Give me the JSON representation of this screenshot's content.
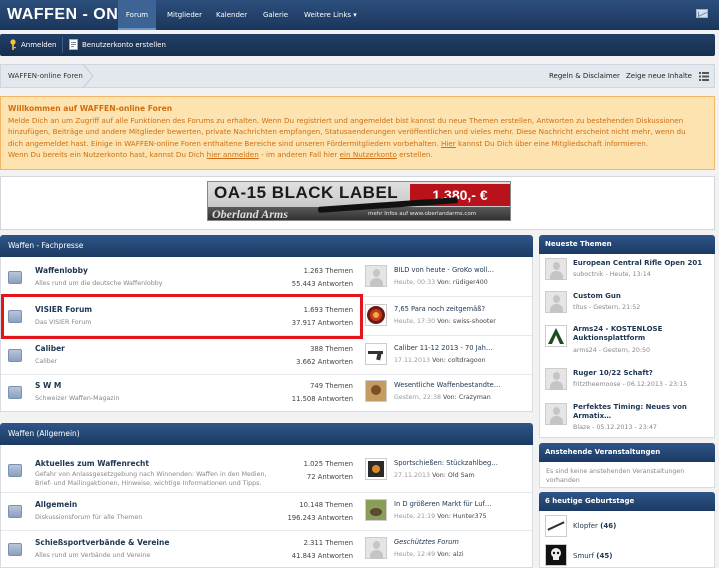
{
  "header": {
    "logo": "WAFFEN - ONLINE",
    "nav": [
      "Forum",
      "Mitglieder",
      "Kalender",
      "Galerie",
      "Weitere Links ▾"
    ]
  },
  "loginbar": {
    "login": "Anmelden",
    "register": "Benutzerkonto erstellen"
  },
  "breadcrumb": {
    "home": "WAFFEN-online Foren",
    "rules": "Regeln & Disclaimer",
    "new_content": "Zeige neue Inhalte"
  },
  "notice": {
    "title": "Willkommen auf WAFFEN-online Foren",
    "line1": "Melde Dich an um Zugriff auf alle Funktionen des Forums zu erhalten. Wenn Du registriert und angemeldet bist kannst du neue Themen erstellen, Antworten zu bestehenden Diskussionen",
    "line2": "hinzufügen, Beiträge und andere Mitglieder bewerten, private Nachrichten empfangen, Statusaenderungen veröffentlichen und vieles mehr. Diese Nachricht erscheint nicht mehr, wenn du",
    "line3a": "dich angemeldet hast. Einige in WAFFEN-online Foren enthaltene Bereiche sind unseren Fördermitgliedern vorbehalten. ",
    "line3_link": "Hier",
    "line3b": " kannst Du Dich über eine Mitgliedschaft informieren.",
    "line4a": "Wenn Du bereits ein Nutzerkonto hast, kannst Du Dich ",
    "line4_link1": "hier anmelden",
    "line4b": " - im anderen Fall hier ",
    "line4_link2": "ein Nutzerkonto",
    "line4c": " erstellen."
  },
  "banner": {
    "title": "OA-15 BLACK LABEL",
    "price": "1.380,- €",
    "brand": "Oberland Arms",
    "url": "mehr Infos auf www.oberlandarms.com"
  },
  "categories": [
    {
      "title": "Waffen - Fachpresse",
      "forums": [
        {
          "title": "Waffenlobby",
          "desc": "Alles rund um die deutsche Waffenlobby",
          "threads": "1.263 Themen",
          "posts": "55.443 Antworten",
          "last_title": "BILD von heute - GroKo woll…",
          "last_time": "Heute, 00:33",
          "last_by_label": "Von:",
          "last_by": "rüdiger400"
        },
        {
          "title": "VISIER Forum",
          "desc": "Das VISIER Forum",
          "threads": "1.693 Themen",
          "posts": "37.917 Antworten",
          "last_title": "7,65 Para noch zeitgemäß?",
          "last_time": "Heute, 17:30",
          "last_by_label": "Von:",
          "last_by": "swiss-shooter"
        },
        {
          "title": "Caliber",
          "desc": "Caliber",
          "threads": "388 Themen",
          "posts": "3.662 Antworten",
          "last_title": "Caliber 11-12 2013 - 70 Jah…",
          "last_time": "17.11.2013",
          "last_by_label": "Von:",
          "last_by": "coltdragoon"
        },
        {
          "title": "S W M",
          "desc": "Schweizer Waffen-Magazin",
          "threads": "749 Themen",
          "posts": "11.508 Antworten",
          "last_title": "Wesentliche Waffenbestandte…",
          "last_time": "Gestern, 22:38",
          "last_by_label": "Von:",
          "last_by": "Crazyman"
        }
      ]
    },
    {
      "title": "Waffen (Allgemein)",
      "forums": [
        {
          "title": "Aktuelles zum Waffenrecht",
          "desc": "Gefahr von Anlassgesetzgebung nach Winnenden: Waffen in den Medien, Brief- und Mailingaktionen, Hinweise, wichtige Informationen und Tipps.",
          "threads": "1.025 Themen",
          "posts": "72 Antworten",
          "last_title": "Sportschießen: Stückzahlbeg…",
          "last_time": "27.11.2013",
          "last_by_label": "Von:",
          "last_by": "Old Sam"
        },
        {
          "title": "Allgemein",
          "desc": "Diskussionsforum für alle Themen",
          "threads": "10.148 Themen",
          "posts": "196.243 Antworten",
          "last_title": "In D größeren Markt für Luf…",
          "last_time": "Heute, 21:19",
          "last_by_label": "Von:",
          "last_by": "Hunter375"
        },
        {
          "title": "Schießsportverbände & Vereine",
          "desc": "Alles rund um Verbände und Vereine",
          "threads": "2.311 Themen",
          "posts": "41.843 Antworten",
          "last_title": "Geschütztes Forum",
          "last_time": "Heute, 12:49",
          "last_by_label": "Von:",
          "last_by": "alzi"
        }
      ]
    }
  ],
  "sidebar": {
    "new_topics_title": "Neueste Themen",
    "new_topics": [
      {
        "title": "European Central Rifle Open 201",
        "meta": "suboctnik - Heute, 13:14"
      },
      {
        "title": "Custom Gun",
        "meta": "titus - Gestern, 21:52"
      },
      {
        "title": "Arms24 - KOSTENLOSE Auktionsplattform",
        "meta": "arms24 - Gestern, 20:50"
      },
      {
        "title": "Ruger 10/22 Schaft?",
        "meta": "fritztheemoose - 06.12.2013 - 23:15"
      },
      {
        "title": "Perfektes Timing: Neues von Armatix…",
        "meta": "Blaze - 05.12.2013 - 23:47"
      }
    ],
    "events_title": "Anstehende Veranstaltungen",
    "events_text": "Es sind keine anstehenden Veranstaltungen vorhanden",
    "birthdays_title": "6 heutige Geburtstage",
    "birthdays": [
      {
        "name": "Klopfer",
        "age": "(46)"
      },
      {
        "name": "Smurf",
        "age": "(45)"
      }
    ]
  }
}
